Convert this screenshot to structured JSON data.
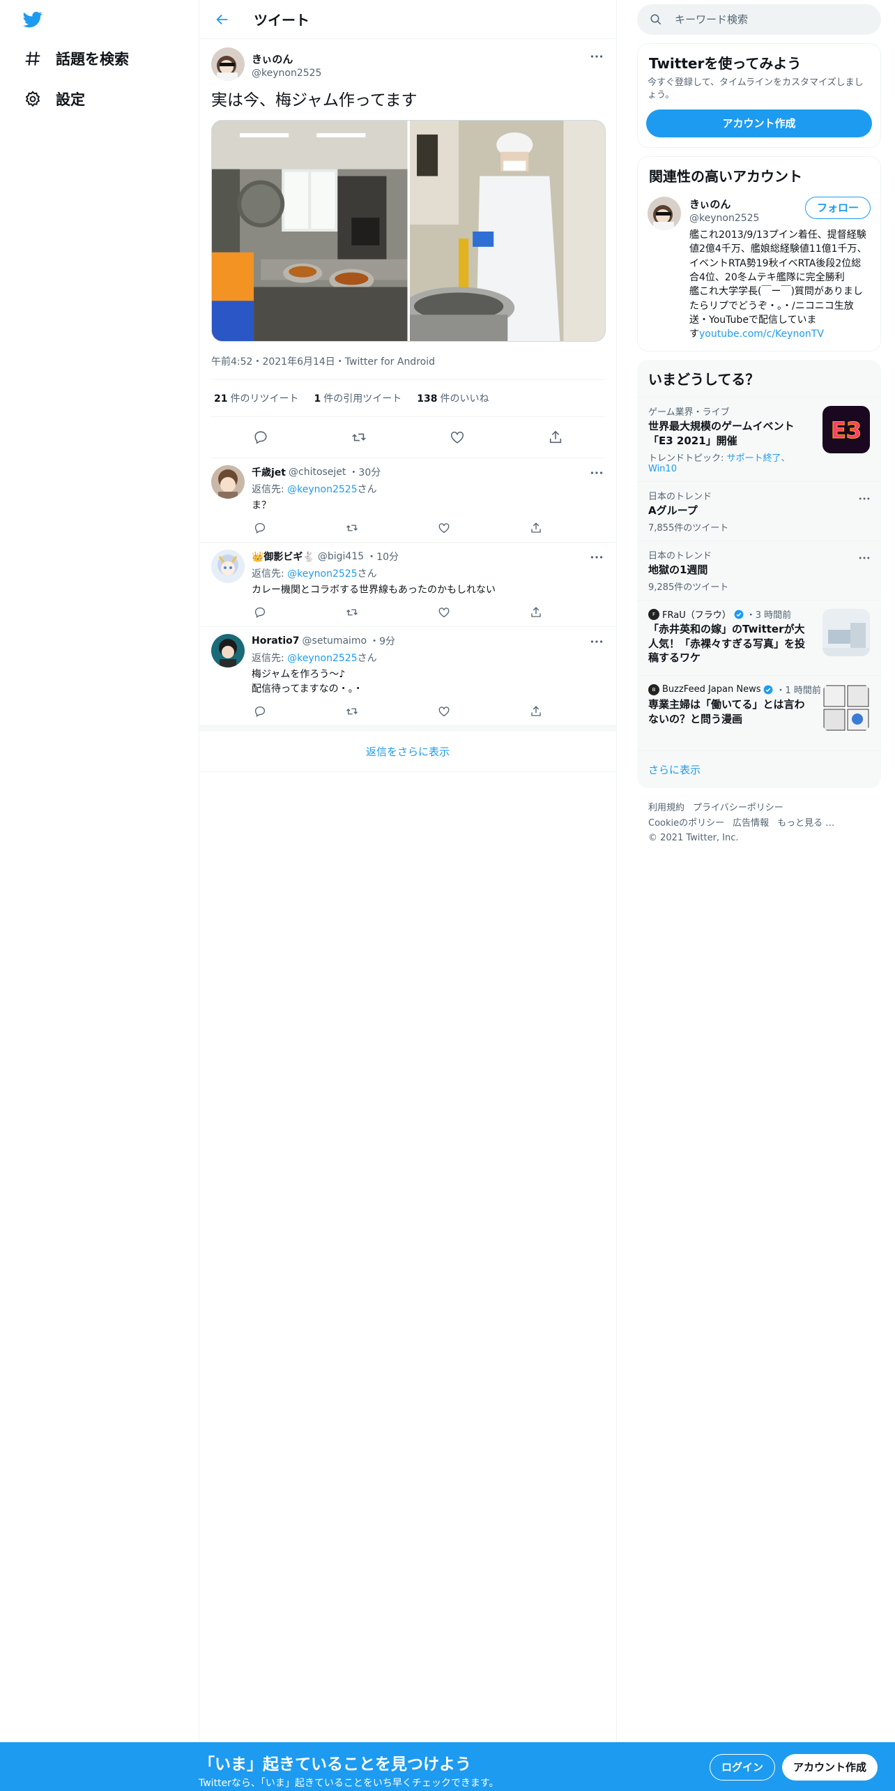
{
  "nav": {
    "logo": "twitter-bird-icon",
    "items": [
      {
        "icon": "hashtag-icon",
        "label": "話題を検索"
      },
      {
        "icon": "gear-icon",
        "label": "設定"
      }
    ]
  },
  "header": {
    "title": "ツイート"
  },
  "tweet": {
    "name": "きぃのん",
    "handle": "@keynon2525",
    "text": "実は今、梅ジャム作ってます",
    "meta": "午前4:52・2021年6月14日・Twitter for Android",
    "stats": {
      "retweets_count": "21",
      "retweets_label": "件のリツイート",
      "quotes_count": "1",
      "quotes_label": "件の引用ツイート",
      "likes_count": "138",
      "likes_label": "件のいいね"
    }
  },
  "replies": [
    {
      "name": "千歳jet",
      "handle": "@chitosejet",
      "time": "・30分",
      "to_prefix": "返信先: ",
      "to_handle": "@keynon2525",
      "to_suffix": "さん",
      "text": "ま？"
    },
    {
      "name": "👑御影ビギ🐇",
      "handle": "@bigi415",
      "time": "・10分",
      "to_prefix": "返信先: ",
      "to_handle": "@keynon2525",
      "to_suffix": "さん",
      "text": "カレー機関とコラボする世界線もあったのかもしれない"
    },
    {
      "name": "Horatio7",
      "handle": "@setumaimo",
      "time": "・9分",
      "to_prefix": "返信先: ",
      "to_handle": "@keynon2525",
      "to_suffix": "さん",
      "text": "梅ジャムを作ろう〜♪\n配信待ってますなの・。・"
    }
  ],
  "show_more_replies": "返信をさらに表示",
  "search": {
    "placeholder": "キーワード検索"
  },
  "signup_card": {
    "title": "Twitterを使ってみよう",
    "subtitle": "今すぐ登録して、タイムラインをカスタマイズしましょう。",
    "button": "アカウント作成"
  },
  "related": {
    "title": "関連性の高いアカウント",
    "name": "きぃのん",
    "handle": "@keynon2525",
    "follow": "フォロー",
    "bio": "艦これ2013/9/13プイン着任、提督経験値2億4千万、艦娘総経験値11億1千万、イベントRTA勢19秋イベRTA後段2位総合4位、20冬ムテキ艦隊に完全勝利　　艦これ大学学長(￣ー￣)質問がありましたらリプでどうぞ・。・/ニコニコ生放送・YouTubeで配信していま\nす",
    "bio_link": "youtube.com/c/KeynonTV"
  },
  "trends": {
    "title": "いまどうしてる？",
    "items": [
      {
        "context": "ゲーム業界・ライブ",
        "title": "世界最大規模のゲームイベント「E3 2021」開催",
        "sub_prefix": "トレンドトピック: ",
        "sub_link": "サポート終了、Win10",
        "thumb": "E3"
      },
      {
        "context": "日本のトレンド",
        "title": "Aグループ",
        "count": "7,855件のツイート"
      },
      {
        "context": "日本のトレンド",
        "title": "地獄の1週間",
        "count": "9,285件のツイート"
      },
      {
        "source": "FRaU（フラウ）",
        "time": "・3 時間前",
        "title": "「赤井英和の嫁」のTwitterが大人気！「赤裸々すぎる写真」を投稿するワケ"
      },
      {
        "source": "BuzzFeed Japan News",
        "time": "・1 時間前",
        "title": "専業主婦は「働いてる」とは言わないの？と問う漫画"
      }
    ],
    "show_more": "さらに表示"
  },
  "footer": {
    "links": [
      "利用規約",
      "プライバシーポリシー",
      "Cookieのポリシー",
      "広告情報",
      "もっと見る …"
    ],
    "copyright": "© 2021 Twitter, Inc."
  },
  "bottom_bar": {
    "headline": "「いま」起きていることを見つけよう",
    "sub": "Twitterなら、「いま」起きていることをいち早くチェックできます。",
    "login": "ログイン",
    "signup": "アカウント作成"
  },
  "colors": {
    "accent": "#1d9bf0",
    "text": "#0f1419",
    "muted": "#536471",
    "border": "#eff3f4"
  }
}
